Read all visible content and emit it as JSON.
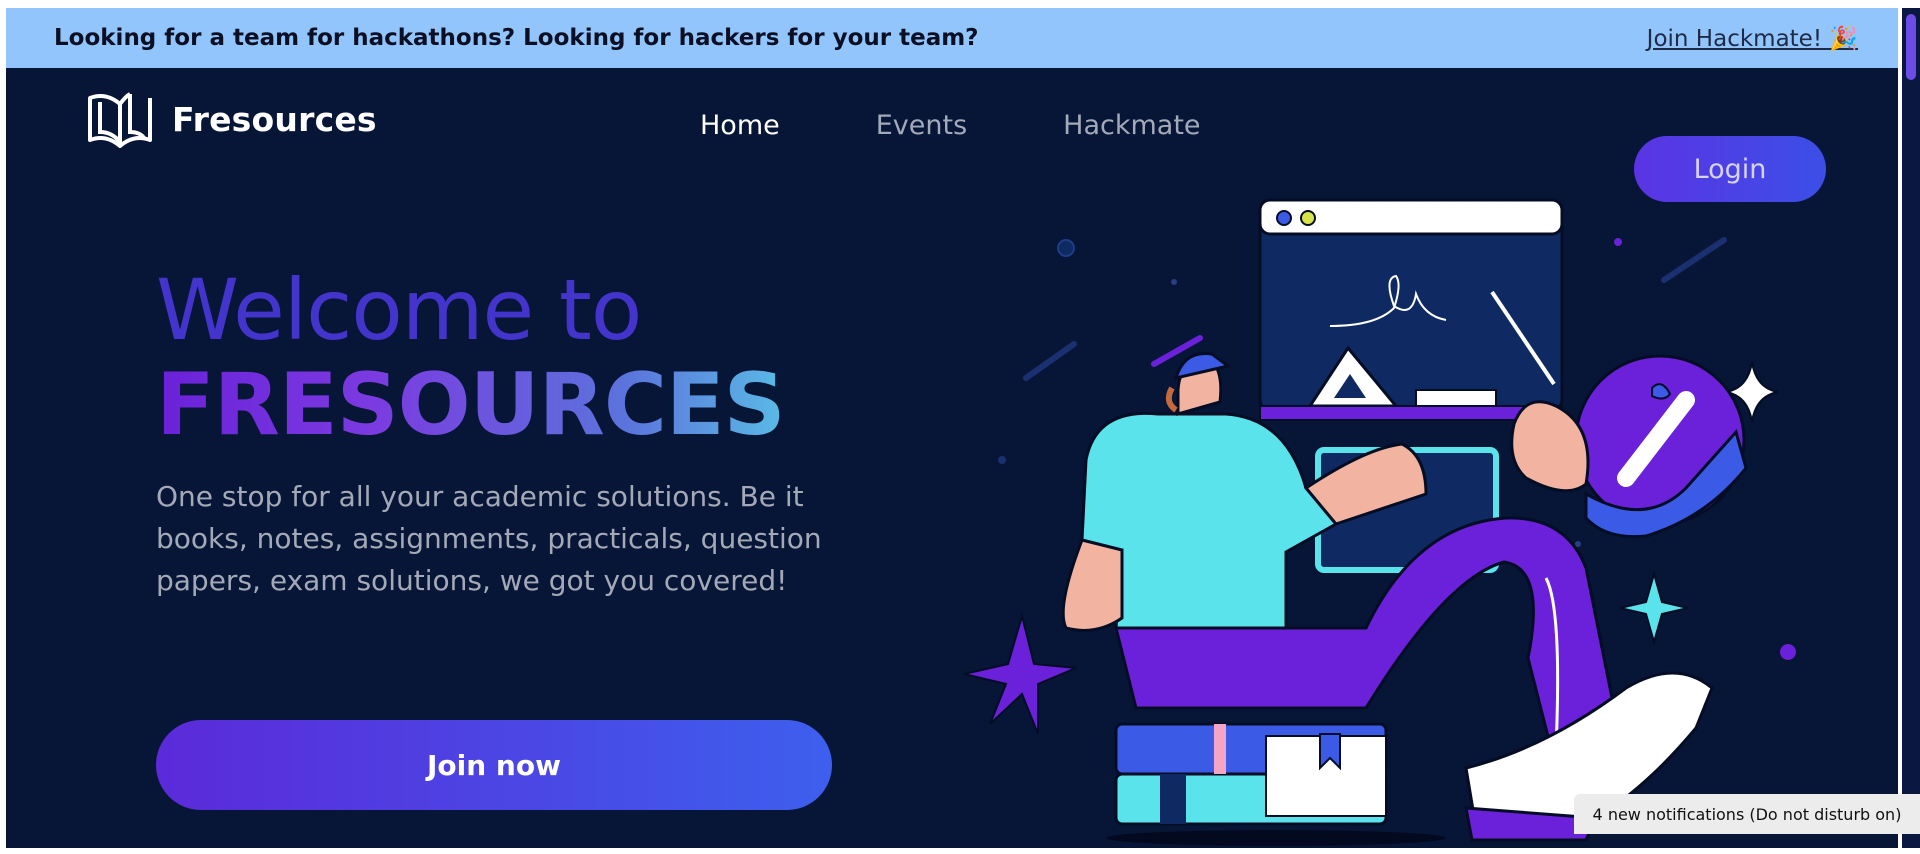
{
  "banner": {
    "text": "Looking for a team for hackathons? Looking for hackers for your team?",
    "link": "Join Hackmate! 🎉"
  },
  "brand": {
    "name": "Fresources",
    "icon": "open-book-logo-icon"
  },
  "nav": {
    "items": [
      {
        "label": "Home",
        "active": true
      },
      {
        "label": "Events",
        "active": false
      },
      {
        "label": "Hackmate",
        "active": false
      }
    ],
    "login_label": "Login"
  },
  "hero": {
    "welcome": "Welcome to",
    "title": "FRESOURCES",
    "description": "One stop for all your academic solutions. Be it books, notes, assignments, practicals, question papers, exam solutions, we got you covered!",
    "cta": "Join now"
  },
  "notification": {
    "text": "4 new notifications (Do not disturb on)"
  },
  "colors": {
    "background": "#071537",
    "banner": "#93c5fd",
    "accent": "#5b34e4",
    "gradient_start": "#6a21d9",
    "gradient_end": "#5ae3ea"
  }
}
